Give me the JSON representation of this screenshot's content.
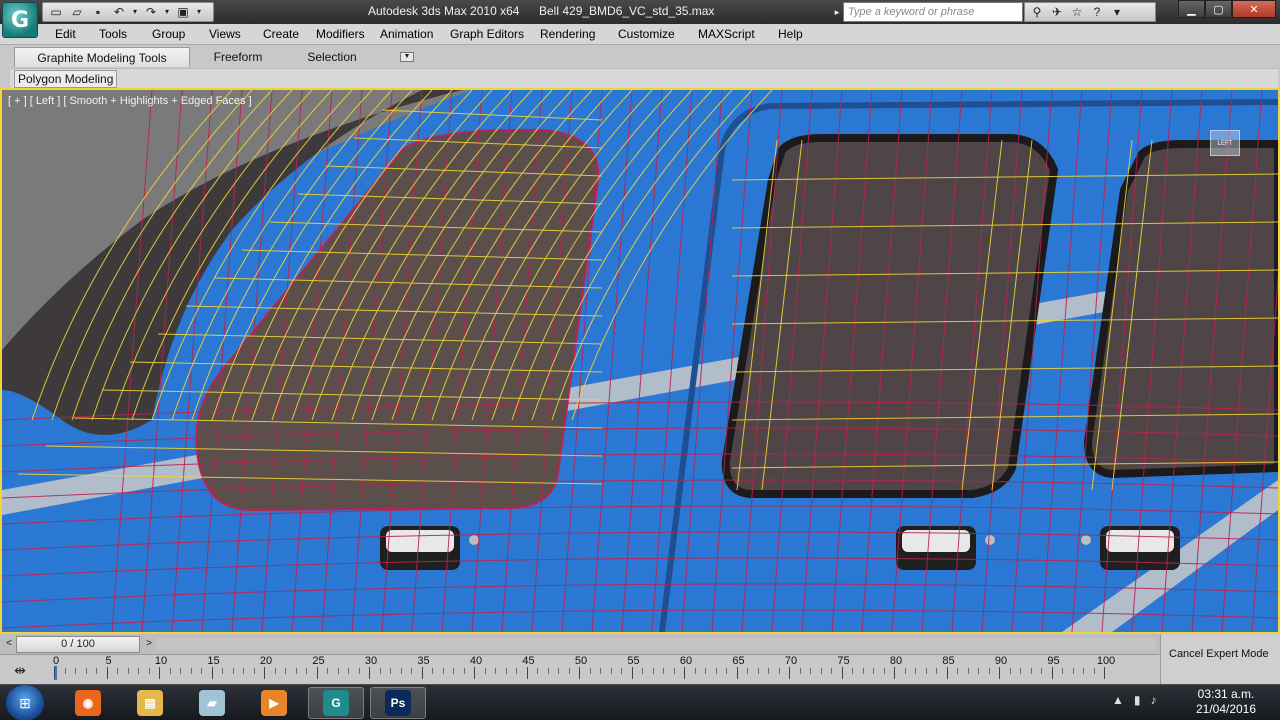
{
  "titlebar": {
    "app_title": "Autodesk 3ds Max  2010 x64",
    "file_name": "Bell 429_BMD6_VC_std_35.max",
    "search_placeholder": "Type a keyword or phrase",
    "logo_glyph": "G",
    "qat_icons": [
      "new-icon",
      "open-icon",
      "save-icon",
      "undo-icon",
      "redo-icon",
      "project-folder-icon"
    ],
    "info_icons": [
      "binoculars-icon",
      "communication-center-icon",
      "favorites-icon",
      "help-icon"
    ]
  },
  "menu": [
    "Edit",
    "Tools",
    "Group",
    "Views",
    "Create",
    "Modifiers",
    "Animation",
    "Graph Editors",
    "Rendering",
    "Customize",
    "MAXScript",
    "Help"
  ],
  "ribbon": {
    "tabs": [
      "Graphite Modeling Tools",
      "Freeform",
      "Selection"
    ],
    "active_tab": "Graphite Modeling Tools",
    "panel_tab": "Polygon Modeling"
  },
  "viewport": {
    "label": "[ + ] [ Left ] [ Smooth + Highlights + Edged Faces ]",
    "viewcube_label": "LEFT",
    "colors": {
      "fuselage": "#2a78d4",
      "wireframe_yellow": "#f0d438",
      "wireframe_red": "#b8234f",
      "window_glass": "#5b4f4c",
      "sky": "#7a7a7a"
    }
  },
  "timeslider": {
    "value_label": "0 / 100",
    "current_frame": 0,
    "total_frames": 100
  },
  "trackbar": {
    "ticks": [
      0,
      5,
      10,
      15,
      20,
      25,
      30,
      35,
      40,
      45,
      50,
      55,
      60,
      65,
      70,
      75,
      80,
      85,
      90,
      95,
      100
    ]
  },
  "expert_mode_label": "Cancel Expert Mode",
  "taskbar": {
    "apps": [
      {
        "name": "firefox",
        "glyph": "◉",
        "color": "#e8671c"
      },
      {
        "name": "file-explorer",
        "glyph": "▤",
        "color": "#e6b84a"
      },
      {
        "name": "notes",
        "glyph": "▰",
        "color": "#9fc4d8"
      },
      {
        "name": "media-player",
        "glyph": "▶",
        "color": "#e8842a"
      },
      {
        "name": "3ds-max",
        "glyph": "G",
        "color": "#1e8c8a"
      },
      {
        "name": "photoshop",
        "glyph": "Ps",
        "color": "#0b2a5c"
      }
    ],
    "time": "03:31 a.m.",
    "date": "21/04/2016"
  }
}
